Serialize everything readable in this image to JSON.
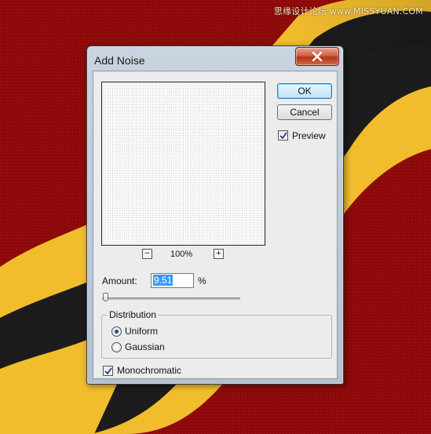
{
  "watermark": "思缘设计论坛 www.MISSYUAN.COM",
  "dialog": {
    "title": "Add Noise",
    "close_label": "X"
  },
  "preview": {
    "zoom_out_label": "−",
    "zoom_level": "100%",
    "zoom_in_label": "+"
  },
  "buttons": {
    "ok_label": "OK",
    "cancel_label": "Cancel"
  },
  "preview_toggle": {
    "label": "Preview",
    "checked": true
  },
  "amount": {
    "label": "Amount:",
    "value": "9.51",
    "unit": "%",
    "slider_fraction": 0.02
  },
  "distribution": {
    "title": "Distribution",
    "options": [
      "Uniform",
      "Gaussian"
    ],
    "selected": "Uniform"
  },
  "monochromatic": {
    "label": "Monochromatic",
    "checked": true
  },
  "colors": {
    "background_red": "#8e0a0a",
    "stripe_yellow": "#f1bd2d",
    "stripe_black": "#1c1c1c",
    "ok_highlight": "#7fd0f7",
    "close_red": "#cf5f45"
  }
}
